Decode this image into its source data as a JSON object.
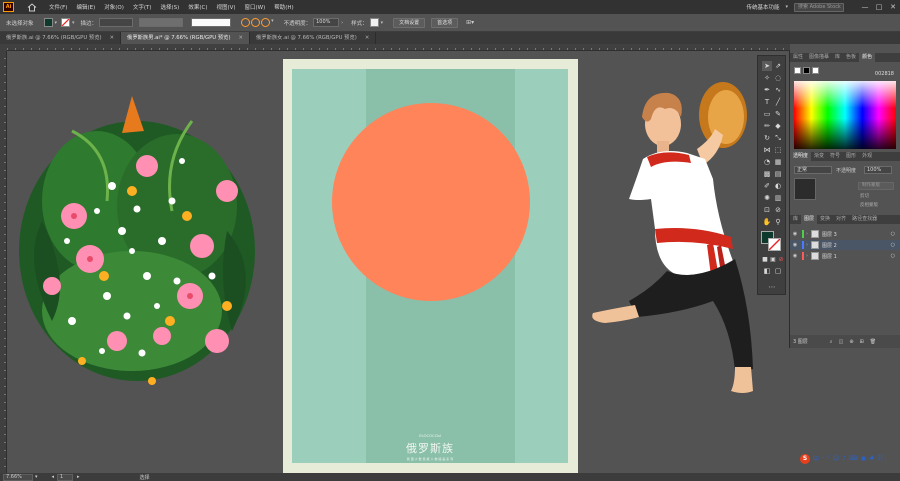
{
  "app": {
    "logo": "Ai"
  },
  "menu": [
    "文件(F)",
    "编辑(E)",
    "对象(O)",
    "文字(T)",
    "选择(S)",
    "效果(C)",
    "视图(V)",
    "窗口(W)",
    "帮助(H)"
  ],
  "window": {
    "workspace": "传统基本功能",
    "search_placeholder": "搜索 Adobe Stock",
    "minimize": "—",
    "maximize": "□",
    "close": "✕"
  },
  "control": {
    "selection": "未选择对象",
    "stroke_label": "描边：",
    "opacity_label": "不透明度：",
    "opacity_value": "100%",
    "style_label": "样式：",
    "doc_setup": "文档设置",
    "preferences": "首选项",
    "colors": {
      "fill": "#0e3a2e"
    }
  },
  "tabs": [
    {
      "label": "俄罗斯族.ai @ 7.66% (RGB/GPU 预览)",
      "active": false
    },
    {
      "label": "俄罗斯族男.ai* @ 7.66% (RGB/GPU 预览)",
      "active": true
    },
    {
      "label": "俄罗斯族女.ai @ 7.66% (RGB/GPU 预览)",
      "active": false
    }
  ],
  "poster": {
    "eng": "ELOCOCCbI",
    "title": "俄罗斯族",
    "subtitle": "我 国 少 数 民 族 人 物 插 画 系 列",
    "colors": {
      "frame": "#e6ecd8",
      "bg": "#9ccfbb",
      "strip": "#8abfa9",
      "sun": "#ff845a"
    }
  },
  "panels": {
    "top_tabs": [
      "属性",
      "图像描摹",
      "库",
      "色板",
      "颜色"
    ],
    "color_hex": "002818",
    "mid_tabs": [
      "透明度",
      "渐变",
      "符号",
      "图形",
      "外观"
    ],
    "blend_mode": "正常",
    "opacity_label": "不透明度",
    "opacity_value": "100%",
    "make_mask": "制作蒙版",
    "clip": "剪切",
    "invert_mask": "反相蒙版",
    "layer_tabs": [
      "库",
      "图层",
      "变换",
      "对齐",
      "路径查找器"
    ],
    "layers": [
      {
        "name": "图层 3",
        "color": "#4ad04a",
        "selected": false
      },
      {
        "name": "图层 2",
        "color": "#4a7aff",
        "selected": true
      },
      {
        "name": "图层 1",
        "color": "#ff5a5a",
        "selected": false
      }
    ],
    "layer_count": "3 图层"
  },
  "status": {
    "zoom": "7.66%",
    "artboard": "1",
    "tool": "选择"
  },
  "ime": {
    "logo": "S",
    "items": [
      "中",
      "·",
      "°",
      "☺",
      "♪",
      "⌨",
      "▣",
      "♣",
      "☷"
    ]
  }
}
